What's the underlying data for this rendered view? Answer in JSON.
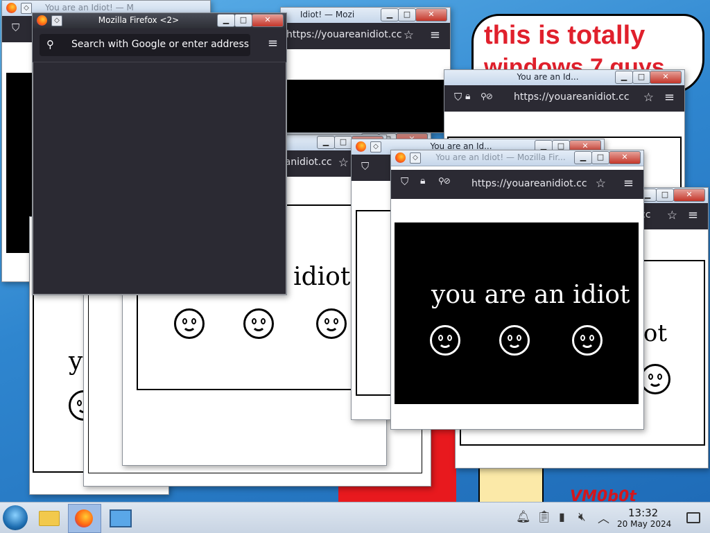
{
  "desktop": {
    "meme_text_line1": "this is totally",
    "meme_text_line2": "windows 7 guys",
    "watermark": "VM0b0t",
    "colors": {
      "meme_text": "#e0202c",
      "bg_top": "#5fb2ea",
      "bg_bottom": "#1f6cb8"
    }
  },
  "browser": {
    "url": "https://youareanidiot.cc",
    "url_short": "eanidiot.cc",
    "url_short2": "cc",
    "page_text": "you are an idiot",
    "page_text_clip_1": "an idiot",
    "page_text_clip_2": "yo",
    "page_text_clip_3": "iot",
    "smile_icon": "smiley-face-icon"
  },
  "windows": {
    "active_title": "Mozilla Firefox <2>",
    "search_placeholder": "Search with Google or enter address",
    "title_idiot": "You are an Idiot! — Mozilla Fir...",
    "title_idiot_short": "You are an Idiot! — Mozilla Firefox",
    "title_bg_1": "You are an Idiot!",
    "title_bg_2": "Idiot! — Mozi",
    "title_bg_3": "You are an Id..."
  },
  "taskbar": {
    "time": "13:32",
    "date": "20 May 2024",
    "icons": [
      "start-orb-icon",
      "file-manager-icon",
      "firefox-icon",
      "system-monitor-icon"
    ],
    "tray": [
      "notifications-icon",
      "clipboard-icon",
      "battery-icon",
      "volume-muted-icon",
      "expand-tray-icon",
      "show-desktop-icon"
    ]
  }
}
